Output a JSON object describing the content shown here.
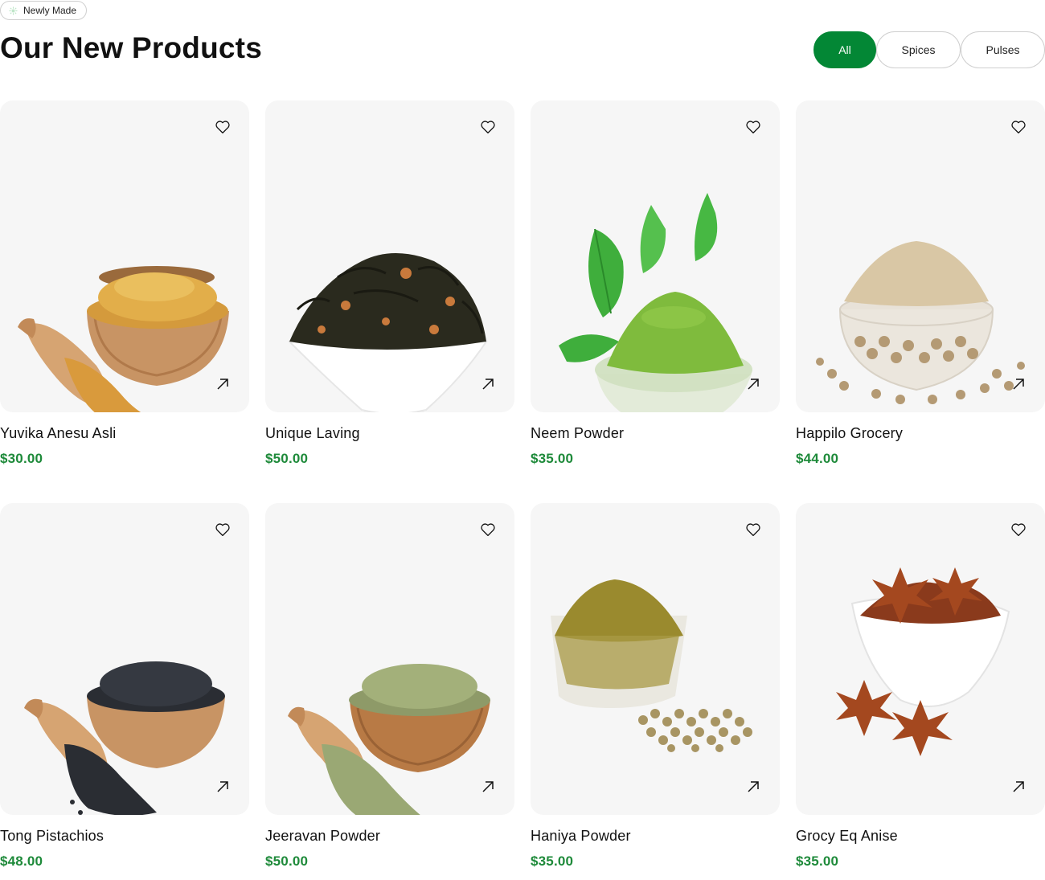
{
  "badge": {
    "label": "Newly Made"
  },
  "page_title": "Our New Products",
  "filters": [
    {
      "label": "All",
      "active": true
    },
    {
      "label": "Spices",
      "active": false
    },
    {
      "label": "Pulses",
      "active": false
    }
  ],
  "colors": {
    "accent": "#038735",
    "price": "#1e8a3a",
    "card_bg": "#f6f6f6"
  },
  "products": [
    {
      "name": "Yuvika Anesu Asli",
      "price": "$30.00",
      "image": "fenugreek-wooden-bowl-scoop"
    },
    {
      "name": "Unique Laving",
      "price": "$50.00",
      "image": "dark-tea-leaves-white-bowl"
    },
    {
      "name": "Neem Powder",
      "price": "$35.00",
      "image": "green-powder-glass-bowl-leaves"
    },
    {
      "name": "Happilo Grocery",
      "price": "$44.00",
      "image": "white-pepper-glass-bowl"
    },
    {
      "name": "Tong Pistachios",
      "price": "$48.00",
      "image": "black-seeds-wooden-bowl-scoop"
    },
    {
      "name": "Jeeravan Powder",
      "price": "$50.00",
      "image": "fennel-seeds-wooden-bowl-scoop"
    },
    {
      "name": "Haniya Powder",
      "price": "$35.00",
      "image": "coriander-powder-glass-bowl"
    },
    {
      "name": "Grocy Eq Anise",
      "price": "$35.00",
      "image": "star-anise-white-bowl"
    }
  ]
}
